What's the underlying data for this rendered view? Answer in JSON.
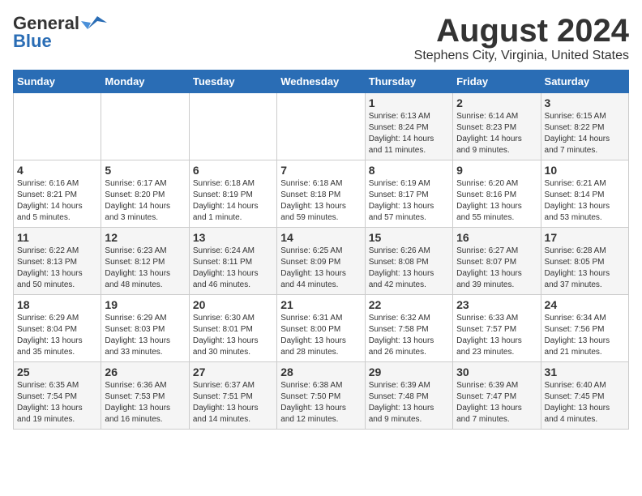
{
  "header": {
    "logo_general": "General",
    "logo_blue": "Blue",
    "month_title": "August 2024",
    "location": "Stephens City, Virginia, United States"
  },
  "days_of_week": [
    "Sunday",
    "Monday",
    "Tuesday",
    "Wednesday",
    "Thursday",
    "Friday",
    "Saturday"
  ],
  "weeks": [
    [
      {
        "day": "",
        "info": ""
      },
      {
        "day": "",
        "info": ""
      },
      {
        "day": "",
        "info": ""
      },
      {
        "day": "",
        "info": ""
      },
      {
        "day": "1",
        "info": "Sunrise: 6:13 AM\nSunset: 8:24 PM\nDaylight: 14 hours\nand 11 minutes."
      },
      {
        "day": "2",
        "info": "Sunrise: 6:14 AM\nSunset: 8:23 PM\nDaylight: 14 hours\nand 9 minutes."
      },
      {
        "day": "3",
        "info": "Sunrise: 6:15 AM\nSunset: 8:22 PM\nDaylight: 14 hours\nand 7 minutes."
      }
    ],
    [
      {
        "day": "4",
        "info": "Sunrise: 6:16 AM\nSunset: 8:21 PM\nDaylight: 14 hours\nand 5 minutes."
      },
      {
        "day": "5",
        "info": "Sunrise: 6:17 AM\nSunset: 8:20 PM\nDaylight: 14 hours\nand 3 minutes."
      },
      {
        "day": "6",
        "info": "Sunrise: 6:18 AM\nSunset: 8:19 PM\nDaylight: 14 hours\nand 1 minute."
      },
      {
        "day": "7",
        "info": "Sunrise: 6:18 AM\nSunset: 8:18 PM\nDaylight: 13 hours\nand 59 minutes."
      },
      {
        "day": "8",
        "info": "Sunrise: 6:19 AM\nSunset: 8:17 PM\nDaylight: 13 hours\nand 57 minutes."
      },
      {
        "day": "9",
        "info": "Sunrise: 6:20 AM\nSunset: 8:16 PM\nDaylight: 13 hours\nand 55 minutes."
      },
      {
        "day": "10",
        "info": "Sunrise: 6:21 AM\nSunset: 8:14 PM\nDaylight: 13 hours\nand 53 minutes."
      }
    ],
    [
      {
        "day": "11",
        "info": "Sunrise: 6:22 AM\nSunset: 8:13 PM\nDaylight: 13 hours\nand 50 minutes."
      },
      {
        "day": "12",
        "info": "Sunrise: 6:23 AM\nSunset: 8:12 PM\nDaylight: 13 hours\nand 48 minutes."
      },
      {
        "day": "13",
        "info": "Sunrise: 6:24 AM\nSunset: 8:11 PM\nDaylight: 13 hours\nand 46 minutes."
      },
      {
        "day": "14",
        "info": "Sunrise: 6:25 AM\nSunset: 8:09 PM\nDaylight: 13 hours\nand 44 minutes."
      },
      {
        "day": "15",
        "info": "Sunrise: 6:26 AM\nSunset: 8:08 PM\nDaylight: 13 hours\nand 42 minutes."
      },
      {
        "day": "16",
        "info": "Sunrise: 6:27 AM\nSunset: 8:07 PM\nDaylight: 13 hours\nand 39 minutes."
      },
      {
        "day": "17",
        "info": "Sunrise: 6:28 AM\nSunset: 8:05 PM\nDaylight: 13 hours\nand 37 minutes."
      }
    ],
    [
      {
        "day": "18",
        "info": "Sunrise: 6:29 AM\nSunset: 8:04 PM\nDaylight: 13 hours\nand 35 minutes."
      },
      {
        "day": "19",
        "info": "Sunrise: 6:29 AM\nSunset: 8:03 PM\nDaylight: 13 hours\nand 33 minutes."
      },
      {
        "day": "20",
        "info": "Sunrise: 6:30 AM\nSunset: 8:01 PM\nDaylight: 13 hours\nand 30 minutes."
      },
      {
        "day": "21",
        "info": "Sunrise: 6:31 AM\nSunset: 8:00 PM\nDaylight: 13 hours\nand 28 minutes."
      },
      {
        "day": "22",
        "info": "Sunrise: 6:32 AM\nSunset: 7:58 PM\nDaylight: 13 hours\nand 26 minutes."
      },
      {
        "day": "23",
        "info": "Sunrise: 6:33 AM\nSunset: 7:57 PM\nDaylight: 13 hours\nand 23 minutes."
      },
      {
        "day": "24",
        "info": "Sunrise: 6:34 AM\nSunset: 7:56 PM\nDaylight: 13 hours\nand 21 minutes."
      }
    ],
    [
      {
        "day": "25",
        "info": "Sunrise: 6:35 AM\nSunset: 7:54 PM\nDaylight: 13 hours\nand 19 minutes."
      },
      {
        "day": "26",
        "info": "Sunrise: 6:36 AM\nSunset: 7:53 PM\nDaylight: 13 hours\nand 16 minutes."
      },
      {
        "day": "27",
        "info": "Sunrise: 6:37 AM\nSunset: 7:51 PM\nDaylight: 13 hours\nand 14 minutes."
      },
      {
        "day": "28",
        "info": "Sunrise: 6:38 AM\nSunset: 7:50 PM\nDaylight: 13 hours\nand 12 minutes."
      },
      {
        "day": "29",
        "info": "Sunrise: 6:39 AM\nSunset: 7:48 PM\nDaylight: 13 hours\nand 9 minutes."
      },
      {
        "day": "30",
        "info": "Sunrise: 6:39 AM\nSunset: 7:47 PM\nDaylight: 13 hours\nand 7 minutes."
      },
      {
        "day": "31",
        "info": "Sunrise: 6:40 AM\nSunset: 7:45 PM\nDaylight: 13 hours\nand 4 minutes."
      }
    ]
  ]
}
